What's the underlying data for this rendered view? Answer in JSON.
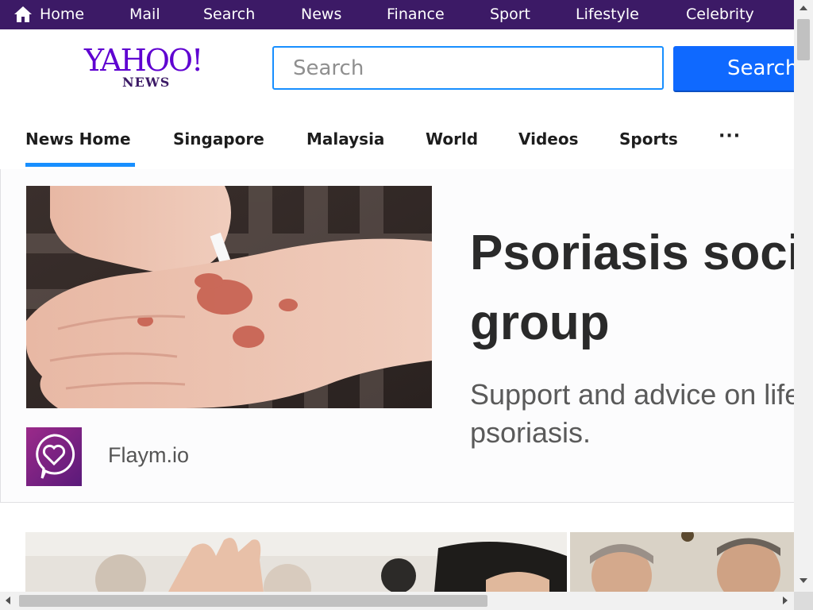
{
  "topbar": {
    "items": [
      {
        "label": "Home"
      },
      {
        "label": "Mail"
      },
      {
        "label": "Search"
      },
      {
        "label": "News"
      },
      {
        "label": "Finance"
      },
      {
        "label": "Sport"
      },
      {
        "label": "Lifestyle"
      },
      {
        "label": "Celebrity"
      }
    ]
  },
  "header": {
    "logo_text": "YAHOO!",
    "logo_sub": "NEWS",
    "search_placeholder": "Search",
    "search_button": "Search"
  },
  "subnav": {
    "tabs": [
      {
        "label": "News Home",
        "active": true
      },
      {
        "label": "Singapore"
      },
      {
        "label": "Malaysia"
      },
      {
        "label": "World"
      },
      {
        "label": "Videos"
      },
      {
        "label": "Sports"
      }
    ],
    "more": "···"
  },
  "ad": {
    "headline_line1": "Psoriasis socia",
    "headline_line2": "group",
    "desc_line1": "Support and advice on life",
    "desc_line2": "psoriasis.",
    "sponsor": "Flaym.io"
  },
  "colors": {
    "topbar": "#3c1a66",
    "accent": "#188fff",
    "search_button": "#0f69ff",
    "logo": "#5f01d1"
  }
}
